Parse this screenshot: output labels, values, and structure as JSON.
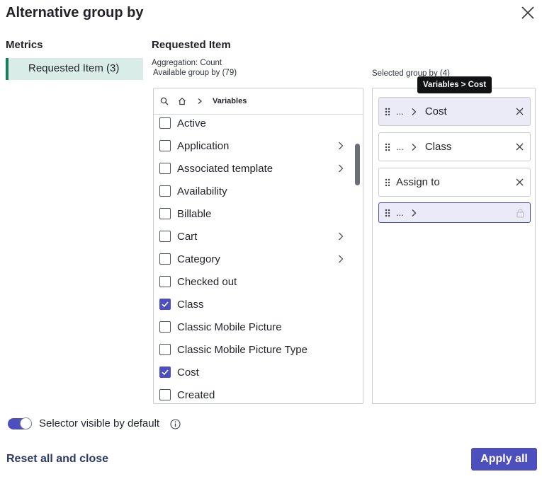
{
  "dialog": {
    "title": "Alternative group by"
  },
  "metrics": {
    "heading": "Metrics",
    "items": [
      {
        "label": "Requested Item (3)"
      }
    ]
  },
  "requested": {
    "heading": "Requested Item",
    "aggregation": "Aggregation: Count",
    "available_label": "Available group by (79)",
    "selected_label": "Selected group by (4)"
  },
  "breadcrumb": {
    "current": "Variables"
  },
  "available_items": [
    {
      "label": "Active",
      "checked": false,
      "has_children": false
    },
    {
      "label": "Application",
      "checked": false,
      "has_children": true
    },
    {
      "label": "Associated template",
      "checked": false,
      "has_children": true
    },
    {
      "label": "Availability",
      "checked": false,
      "has_children": false
    },
    {
      "label": "Billable",
      "checked": false,
      "has_children": false
    },
    {
      "label": "Cart",
      "checked": false,
      "has_children": true
    },
    {
      "label": "Category",
      "checked": false,
      "has_children": true
    },
    {
      "label": "Checked out",
      "checked": false,
      "has_children": false
    },
    {
      "label": "Class",
      "checked": true,
      "has_children": false
    },
    {
      "label": "Classic Mobile Picture",
      "checked": false,
      "has_children": false
    },
    {
      "label": "Classic Mobile Picture Type",
      "checked": false,
      "has_children": false
    },
    {
      "label": "Cost",
      "checked": true,
      "has_children": false
    },
    {
      "label": "Created",
      "checked": false,
      "has_children": false
    }
  ],
  "selected_items": [
    {
      "prefix": "...",
      "label": "Cost"
    },
    {
      "prefix": "...",
      "label": "Class"
    },
    {
      "prefix": "",
      "label": "Assign to"
    },
    {
      "prefix": "...",
      "label": ""
    }
  ],
  "tooltip": "Variables > Cost",
  "toggle": {
    "label": "Selector visible by default",
    "on": true
  },
  "footer": {
    "reset_label": "Reset all and close",
    "apply_label": "Apply all"
  },
  "colors": {
    "accent": "#4c4fbd",
    "metric_highlight": "#d9ece8",
    "metric_border": "#16805e",
    "link": "#2b3a67"
  }
}
